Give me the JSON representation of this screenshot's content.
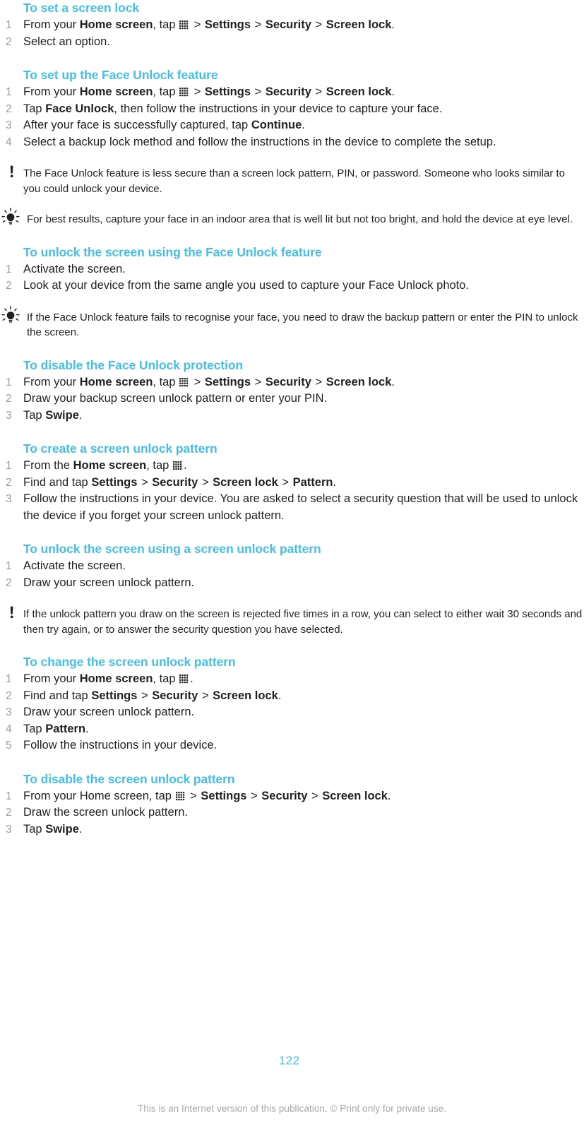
{
  "colors": {
    "heading": "#45bfe4",
    "body": "#231f20",
    "list_number": "#9b9b9b",
    "footer": "#a7a7a7",
    "page_number": "#45bfe4"
  },
  "icons": {
    "app_drawer": "app-drawer-grid-icon",
    "note": "exclamation-note-icon",
    "tip": "lightbulb-tip-icon"
  },
  "sections": [
    {
      "heading": "To set a screen lock",
      "steps": [
        {
          "num": "1",
          "parts": [
            {
              "t": "From your ",
              "s": "plain"
            },
            {
              "t": "Home screen",
              "s": "bold"
            },
            {
              "t": ", tap ",
              "s": "plain"
            },
            {
              "t": "",
              "s": "grid"
            },
            {
              "t": " > ",
              "s": "sep"
            },
            {
              "t": "Settings",
              "s": "bold"
            },
            {
              "t": " > ",
              "s": "sep"
            },
            {
              "t": "Security",
              "s": "bold"
            },
            {
              "t": " > ",
              "s": "sep"
            },
            {
              "t": "Screen lock",
              "s": "bold"
            },
            {
              "t": ".",
              "s": "plain"
            }
          ]
        },
        {
          "num": "2",
          "parts": [
            {
              "t": "Select an option.",
              "s": "plain"
            }
          ]
        }
      ],
      "notes": []
    },
    {
      "heading": "To set up the Face Unlock feature",
      "steps": [
        {
          "num": "1",
          "parts": [
            {
              "t": "From your ",
              "s": "plain"
            },
            {
              "t": "Home screen",
              "s": "bold"
            },
            {
              "t": ", tap ",
              "s": "plain"
            },
            {
              "t": "",
              "s": "grid"
            },
            {
              "t": " > ",
              "s": "sep"
            },
            {
              "t": "Settings",
              "s": "bold"
            },
            {
              "t": " > ",
              "s": "sep"
            },
            {
              "t": "Security",
              "s": "bold"
            },
            {
              "t": " > ",
              "s": "sep"
            },
            {
              "t": "Screen lock",
              "s": "bold"
            },
            {
              "t": ".",
              "s": "plain"
            }
          ]
        },
        {
          "num": "2",
          "parts": [
            {
              "t": "Tap ",
              "s": "plain"
            },
            {
              "t": "Face Unlock",
              "s": "bold"
            },
            {
              "t": ", then follow the instructions in your device to capture your face.",
              "s": "plain"
            }
          ]
        },
        {
          "num": "3",
          "parts": [
            {
              "t": "After your face is successfully captured, tap ",
              "s": "plain"
            },
            {
              "t": "Continue",
              "s": "bold"
            },
            {
              "t": ".",
              "s": "plain"
            }
          ]
        },
        {
          "num": "4",
          "parts": [
            {
              "t": "Select a backup lock method and follow the instructions in the device to complete the setup.",
              "s": "plain"
            }
          ]
        }
      ],
      "notes": [
        {
          "type": "note",
          "text": "The Face Unlock feature is less secure than a screen lock pattern, PIN, or password. Someone who looks similar to you could unlock your device."
        },
        {
          "type": "tip",
          "text": "For best results, capture your face in an indoor area that is well lit but not too bright, and hold the device at eye level."
        }
      ]
    },
    {
      "heading": "To unlock the screen using the Face Unlock feature",
      "steps": [
        {
          "num": "1",
          "parts": [
            {
              "t": "Activate the screen.",
              "s": "plain"
            }
          ]
        },
        {
          "num": "2",
          "parts": [
            {
              "t": "Look at your device from the same angle you used to capture your Face Unlock photo.",
              "s": "plain"
            }
          ]
        }
      ],
      "notes": [
        {
          "type": "tip",
          "text": "If the Face Unlock feature fails to recognise your face, you need to draw the backup pattern or enter the PIN to unlock the screen."
        }
      ]
    },
    {
      "heading": "To disable the Face Unlock protection",
      "steps": [
        {
          "num": "1",
          "parts": [
            {
              "t": "From your ",
              "s": "plain"
            },
            {
              "t": "Home screen",
              "s": "bold"
            },
            {
              "t": ", tap ",
              "s": "plain"
            },
            {
              "t": "",
              "s": "grid"
            },
            {
              "t": " > ",
              "s": "sep"
            },
            {
              "t": "Settings",
              "s": "bold"
            },
            {
              "t": " > ",
              "s": "sep"
            },
            {
              "t": "Security",
              "s": "bold"
            },
            {
              "t": " > ",
              "s": "sep"
            },
            {
              "t": "Screen lock",
              "s": "bold"
            },
            {
              "t": ".",
              "s": "plain"
            }
          ]
        },
        {
          "num": "2",
          "parts": [
            {
              "t": "Draw your backup screen unlock pattern or enter your PIN.",
              "s": "plain"
            }
          ]
        },
        {
          "num": "3",
          "parts": [
            {
              "t": "Tap ",
              "s": "plain"
            },
            {
              "t": "Swipe",
              "s": "bold"
            },
            {
              "t": ".",
              "s": "plain"
            }
          ]
        }
      ],
      "notes": []
    },
    {
      "heading": "To create a screen unlock pattern",
      "steps": [
        {
          "num": "1",
          "parts": [
            {
              "t": "From the ",
              "s": "plain"
            },
            {
              "t": "Home screen",
              "s": "bold"
            },
            {
              "t": ", tap ",
              "s": "plain"
            },
            {
              "t": "",
              "s": "grid"
            },
            {
              "t": ".",
              "s": "plain"
            }
          ]
        },
        {
          "num": "2",
          "parts": [
            {
              "t": "Find and tap ",
              "s": "plain"
            },
            {
              "t": "Settings",
              "s": "bold"
            },
            {
              "t": " > ",
              "s": "sep"
            },
            {
              "t": "Security",
              "s": "bold"
            },
            {
              "t": " > ",
              "s": "sep"
            },
            {
              "t": "Screen lock",
              "s": "bold"
            },
            {
              "t": " > ",
              "s": "sep"
            },
            {
              "t": "Pattern",
              "s": "bold"
            },
            {
              "t": ".",
              "s": "plain"
            }
          ]
        },
        {
          "num": "3",
          "parts": [
            {
              "t": "Follow the instructions in your device. You are asked to select a security question that will be used to unlock the device if you forget your screen unlock pattern.",
              "s": "plain"
            }
          ]
        }
      ],
      "notes": []
    },
    {
      "heading": "To unlock the screen using a screen unlock pattern",
      "steps": [
        {
          "num": "1",
          "parts": [
            {
              "t": "Activate the screen.",
              "s": "plain"
            }
          ]
        },
        {
          "num": "2",
          "parts": [
            {
              "t": "Draw your screen unlock pattern.",
              "s": "plain"
            }
          ]
        }
      ],
      "notes": [
        {
          "type": "note",
          "text": "If the unlock pattern you draw on the screen is rejected five times in a row, you can select to either wait 30 seconds and then try again, or to answer the security question you have selected."
        }
      ]
    },
    {
      "heading": "To change the screen unlock pattern",
      "steps": [
        {
          "num": "1",
          "parts": [
            {
              "t": "From your ",
              "s": "plain"
            },
            {
              "t": "Home screen",
              "s": "bold"
            },
            {
              "t": ", tap ",
              "s": "plain"
            },
            {
              "t": "",
              "s": "grid"
            },
            {
              "t": ".",
              "s": "plain"
            }
          ]
        },
        {
          "num": "2",
          "parts": [
            {
              "t": "Find and tap ",
              "s": "plain"
            },
            {
              "t": "Settings",
              "s": "bold"
            },
            {
              "t": " > ",
              "s": "sep"
            },
            {
              "t": "Security",
              "s": "bold"
            },
            {
              "t": " > ",
              "s": "sep"
            },
            {
              "t": "Screen lock",
              "s": "bold"
            },
            {
              "t": ".",
              "s": "plain"
            }
          ]
        },
        {
          "num": "3",
          "parts": [
            {
              "t": "Draw your screen unlock pattern.",
              "s": "plain"
            }
          ]
        },
        {
          "num": "4",
          "parts": [
            {
              "t": "Tap ",
              "s": "plain"
            },
            {
              "t": "Pattern",
              "s": "bold"
            },
            {
              "t": ".",
              "s": "plain"
            }
          ]
        },
        {
          "num": "5",
          "parts": [
            {
              "t": "Follow the instructions in your device.",
              "s": "plain"
            }
          ]
        }
      ],
      "notes": []
    },
    {
      "heading": "To disable the screen unlock pattern",
      "steps": [
        {
          "num": "1",
          "parts": [
            {
              "t": "From your Home screen, tap ",
              "s": "plain"
            },
            {
              "t": "",
              "s": "grid"
            },
            {
              "t": " > ",
              "s": "sep"
            },
            {
              "t": "Settings",
              "s": "bold"
            },
            {
              "t": " > ",
              "s": "sep"
            },
            {
              "t": "Security",
              "s": "bold"
            },
            {
              "t": " > ",
              "s": "sep"
            },
            {
              "t": "Screen lock",
              "s": "bold"
            },
            {
              "t": ".",
              "s": "plain"
            }
          ]
        },
        {
          "num": "2",
          "parts": [
            {
              "t": "Draw the screen unlock pattern.",
              "s": "plain"
            }
          ]
        },
        {
          "num": "3",
          "parts": [
            {
              "t": "Tap ",
              "s": "plain"
            },
            {
              "t": "Swipe",
              "s": "bold"
            },
            {
              "t": ".",
              "s": "plain"
            }
          ]
        }
      ],
      "notes": []
    }
  ],
  "footer": {
    "page_number": "122",
    "legal": "This is an Internet version of this publication. © Print only for private use."
  }
}
